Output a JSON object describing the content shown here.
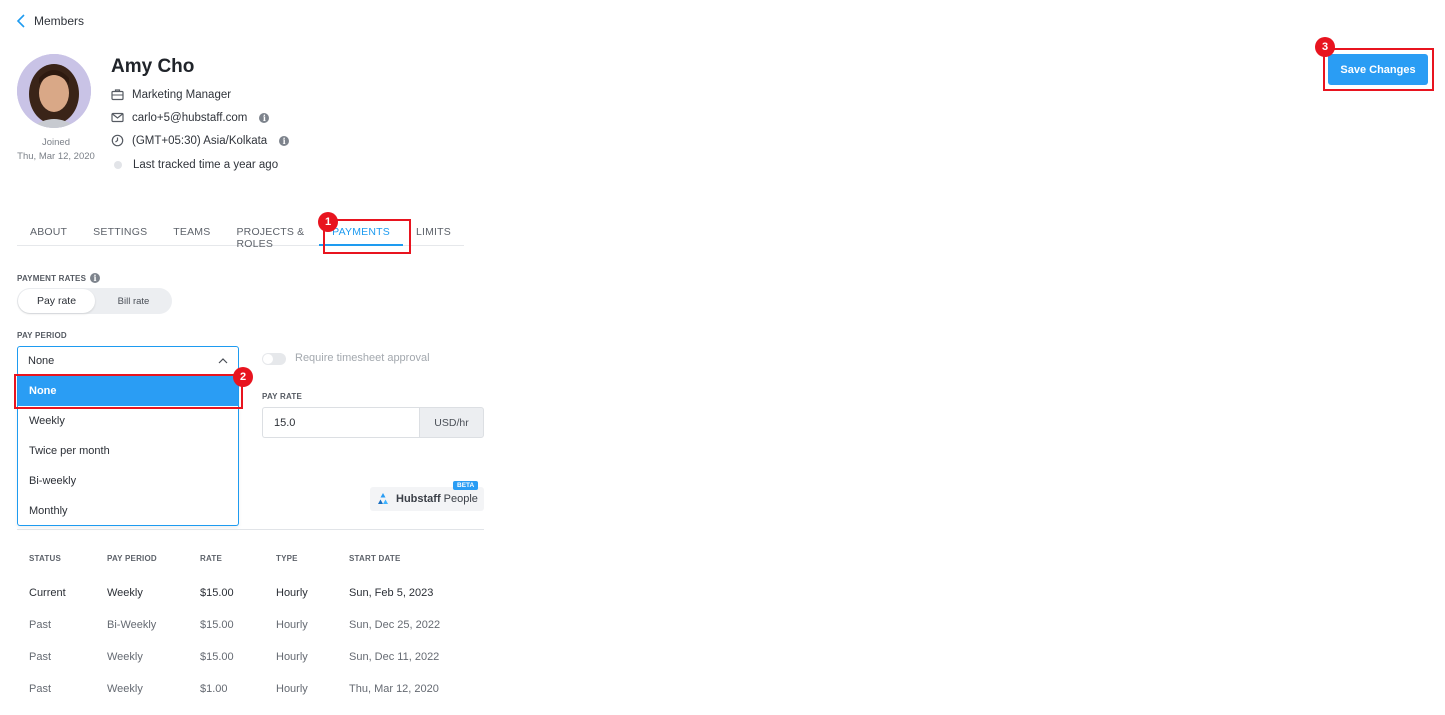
{
  "nav": {
    "back_label": "Members"
  },
  "profile": {
    "name": "Amy Cho",
    "joined_label": "Joined",
    "joined_date": "Thu, Mar 12, 2020",
    "title": "Marketing Manager",
    "email": "carlo+5@hubstaff.com",
    "timezone": "(GMT+05:30) Asia/Kolkata",
    "last_tracked": "Last tracked time a year ago"
  },
  "tabs": [
    {
      "label": "ABOUT"
    },
    {
      "label": "SETTINGS"
    },
    {
      "label": "TEAMS"
    },
    {
      "label": "PROJECTS & ROLES"
    },
    {
      "label": "PAYMENTS",
      "active": true
    },
    {
      "label": "LIMITS"
    }
  ],
  "payments": {
    "rates_label": "PAYMENT RATES",
    "pay_rate_tab": "Pay rate",
    "bill_rate_tab": "Bill rate",
    "pay_period_label": "PAY PERIOD",
    "pay_period_value": "None",
    "pay_period_options": [
      "None",
      "Weekly",
      "Twice per month",
      "Bi-weekly",
      "Monthly"
    ],
    "timesheet_toggle_label": "Require timesheet approval",
    "timesheet_toggle_on": false,
    "pay_rate_label": "PAY RATE",
    "pay_rate_value": "15.0",
    "pay_rate_unit": "USD/hr",
    "people_brand": "Hubstaff",
    "people_brand_suffix": "People",
    "beta_label": "BETA"
  },
  "history": {
    "headers": [
      "STATUS",
      "PAY PERIOD",
      "RATE",
      "TYPE",
      "START DATE"
    ],
    "rows": [
      [
        "Current",
        "Weekly",
        "$15.00",
        "Hourly",
        "Sun, Feb 5, 2023"
      ],
      [
        "Past",
        "Bi-Weekly",
        "$15.00",
        "Hourly",
        "Sun, Dec 25, 2022"
      ],
      [
        "Past",
        "Weekly",
        "$15.00",
        "Hourly",
        "Sun, Dec 11, 2022"
      ],
      [
        "Past",
        "Weekly",
        "$1.00",
        "Hourly",
        "Thu, Mar 12, 2020"
      ]
    ]
  },
  "actions": {
    "save_label": "Save Changes"
  },
  "annotations": {
    "step1": "1",
    "step2": "2",
    "step3": "3"
  },
  "colors": {
    "accent": "#2a9df4",
    "annotation_red": "#e8141f"
  }
}
